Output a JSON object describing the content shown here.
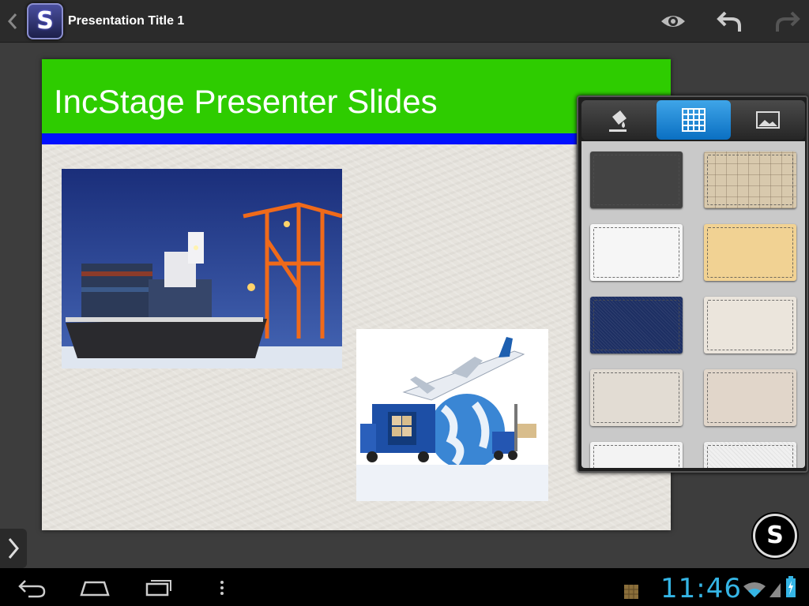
{
  "app": {
    "title": "Presentation Title 1",
    "icon": "incstage-s-logo"
  },
  "toolbar": {
    "icons": [
      "back-caret-icon",
      "eye-icon",
      "undo-icon",
      "redo-icon"
    ]
  },
  "slide": {
    "title": "IncStage Presenter Slides",
    "header_color": "#2ecc00",
    "rule_color": "#0010ff",
    "images": [
      "container ship at port",
      "cargo logistics airplane and globe"
    ]
  },
  "panel": {
    "tabs": [
      {
        "name": "fill",
        "icon": "paint-bucket-icon",
        "active": false
      },
      {
        "name": "texture",
        "icon": "grid-icon",
        "active": true
      },
      {
        "name": "image",
        "icon": "picture-icon",
        "active": false
      }
    ],
    "swatches": [
      "dark-leather",
      "beige-tile",
      "white-leather",
      "tan-paper",
      "denim",
      "linen",
      "light-canvas",
      "cream-paper",
      "white-fabric",
      "white-mesh"
    ],
    "accent": "#0a6fc2"
  },
  "status": {
    "time": "11:46",
    "time_color": "#35b5e5"
  }
}
